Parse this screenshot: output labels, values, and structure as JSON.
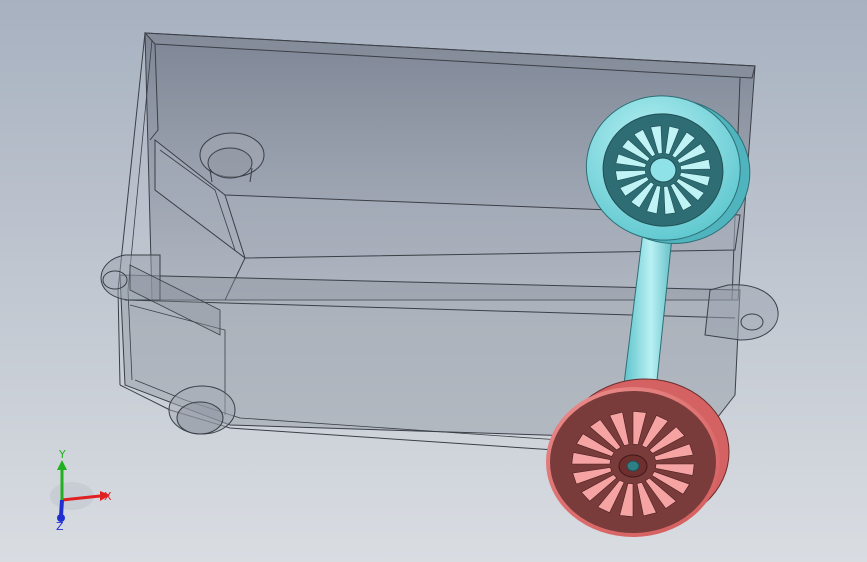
{
  "viewport": {
    "background_top": "#a7b1c0",
    "background_bottom": "#d9dde2"
  },
  "model": {
    "housing": {
      "icon": "transparent-box-housing",
      "edge_color": "#3b3f46",
      "fill_color": "#7e8594"
    },
    "rear_wheel": {
      "icon": "spoked-wheel",
      "color": "#7fdbe0"
    },
    "front_wheel": {
      "icon": "spoked-wheel",
      "color": "#f08080"
    },
    "axle": {
      "icon": "axle-shaft",
      "color": "#7fdbe0"
    }
  },
  "triad": {
    "x_label": "X",
    "y_label": "Y",
    "z_label": "Z",
    "x_color": "#e02020",
    "y_color": "#20b020",
    "z_color": "#2030d0"
  }
}
